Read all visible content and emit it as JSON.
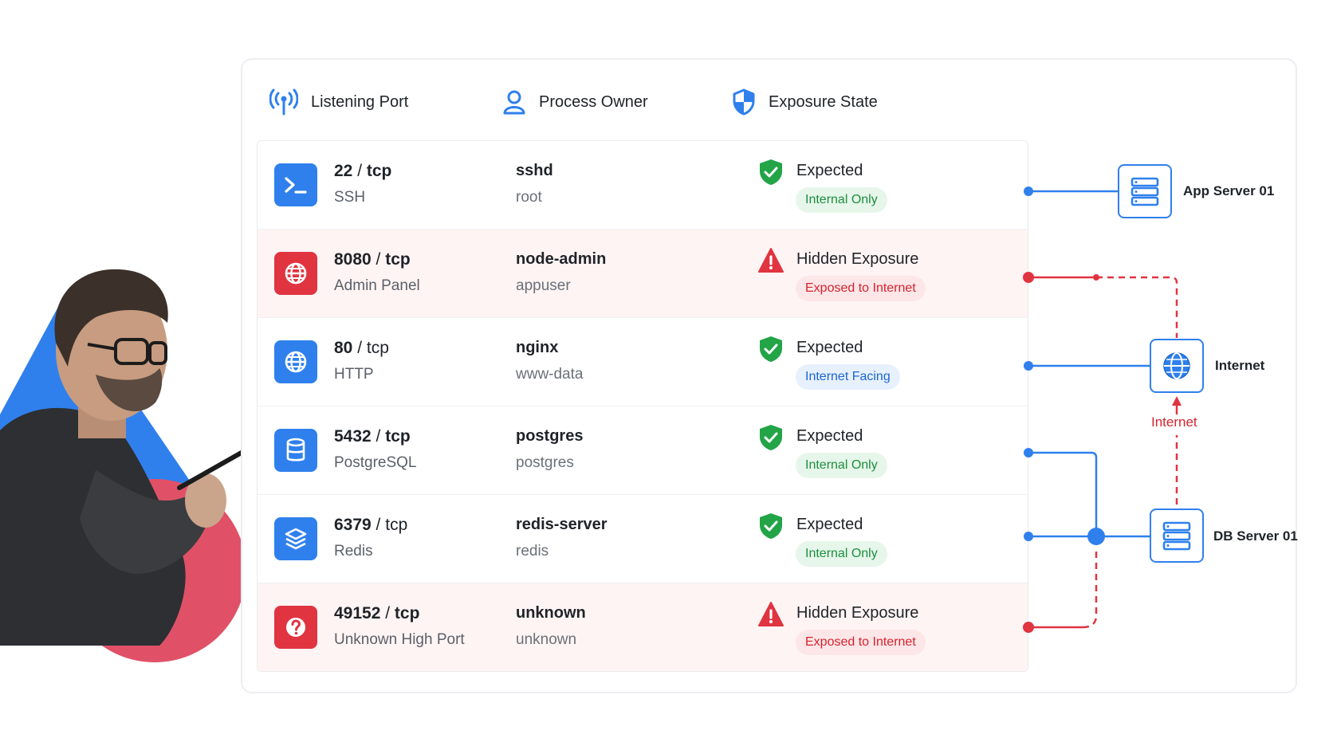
{
  "columns": {
    "port": "Listening Port",
    "owner": "Process Owner",
    "state": "Exposure State"
  },
  "rows": [
    {
      "port_num": "22",
      "proto": "tcp",
      "service": "SSH",
      "process": "sshd",
      "owner": "root",
      "state": "Expected",
      "badge": "Internal Only",
      "icon": "terminal-icon",
      "severity": "ok"
    },
    {
      "port_num": "8080",
      "proto": "tcp",
      "service": "Admin Panel",
      "process": "node-admin",
      "owner": "appuser",
      "state": "Hidden Exposure",
      "badge": "Exposed to Internet",
      "icon": "globe-icon",
      "severity": "danger"
    },
    {
      "port_num": "80",
      "proto": "tcp",
      "service": "HTTP",
      "process": "nginx",
      "owner": "www-data",
      "state": "Expected",
      "badge": "Internet Facing",
      "icon": "globe-icon",
      "severity": "ok"
    },
    {
      "port_num": "5432",
      "proto": "tcp",
      "service": "PostgreSQL",
      "process": "postgres",
      "owner": "postgres",
      "state": "Expected",
      "badge": "Internal Only",
      "icon": "database-icon",
      "severity": "ok"
    },
    {
      "port_num": "6379",
      "proto": "tcp",
      "service": "Redis",
      "process": "redis-server",
      "owner": "redis",
      "state": "Expected",
      "badge": "Internal Only",
      "icon": "layers-icon",
      "severity": "ok"
    },
    {
      "port_num": "49152",
      "proto": "tcp",
      "service": "Unknown High Port",
      "process": "unknown",
      "owner": "unknown",
      "state": "Hidden Exposure",
      "badge": "Exposed to Internet",
      "icon": "question-icon",
      "severity": "danger"
    }
  ],
  "topology": {
    "app_server": "App Server 01",
    "internet": "Internet",
    "db_server": "DB Server 01",
    "edge_label": "Internet"
  },
  "colors": {
    "accent_blue": "#2f80ed",
    "danger_red": "#e03441",
    "ok_green": "#1e8e3e"
  }
}
